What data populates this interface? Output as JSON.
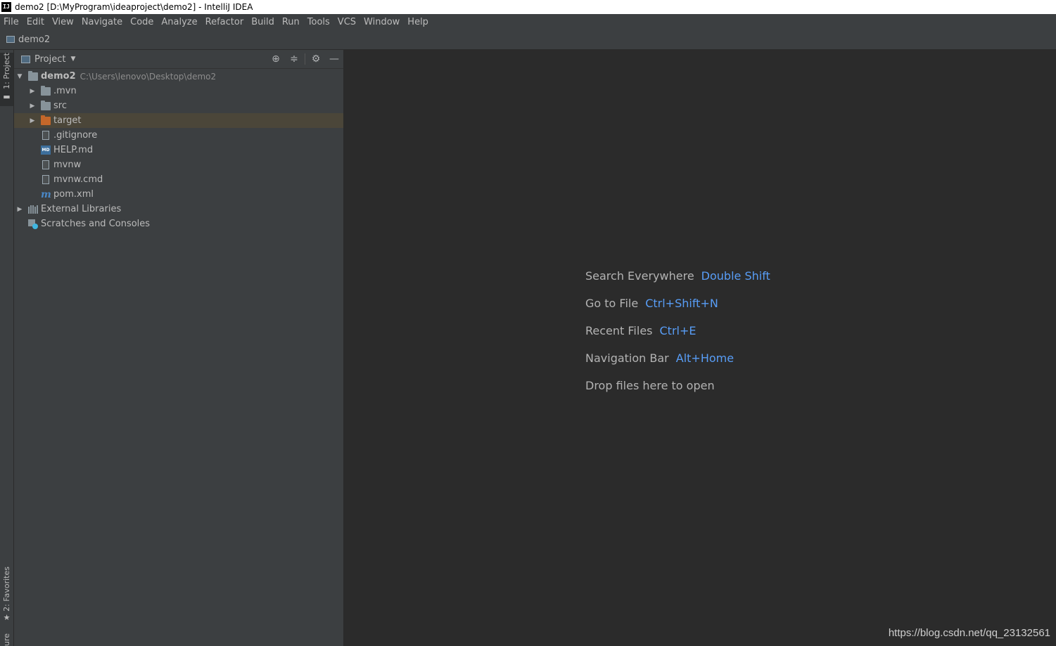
{
  "window": {
    "title": "demo2 [D:\\MyProgram\\ideaproject\\demo2] - IntelliJ IDEA",
    "logo_text": "IJ"
  },
  "menu": [
    "File",
    "Edit",
    "View",
    "Navigate",
    "Code",
    "Analyze",
    "Refactor",
    "Build",
    "Run",
    "Tools",
    "VCS",
    "Window",
    "Help"
  ],
  "navbar": {
    "crumb": "demo2"
  },
  "stripe": {
    "project": "1: Project",
    "favorites": "2: Favorites",
    "structure": "ure"
  },
  "panel": {
    "title": "Project",
    "tools": {
      "locate": "⊕",
      "collapse": "≑",
      "settings": "⚙",
      "hide": "—"
    }
  },
  "tree": {
    "root": {
      "name": "demo2",
      "path": "C:\\Users\\lenovo\\Desktop\\demo2"
    },
    "items": [
      {
        "name": ".mvn"
      },
      {
        "name": "src"
      },
      {
        "name": "target"
      },
      {
        "name": ".gitignore"
      },
      {
        "name": "HELP.md"
      },
      {
        "name": "mvnw"
      },
      {
        "name": "mvnw.cmd"
      },
      {
        "name": "pom.xml"
      }
    ],
    "external_libraries": "External Libraries",
    "scratches": "Scratches and Consoles"
  },
  "editor": {
    "hints": [
      {
        "label": "Search Everywhere",
        "key": "Double Shift"
      },
      {
        "label": "Go to File",
        "key": "Ctrl+Shift+N"
      },
      {
        "label": "Recent Files",
        "key": "Ctrl+E"
      },
      {
        "label": "Navigation Bar",
        "key": "Alt+Home"
      },
      {
        "label": "Drop files here to open",
        "key": ""
      }
    ]
  },
  "watermark": "https://blog.csdn.net/qq_23132561",
  "colors": {
    "accent": "#589df6",
    "selected_row": "#4b4639",
    "panel_bg": "#3c3f41",
    "editor_bg": "#2b2b2b"
  }
}
